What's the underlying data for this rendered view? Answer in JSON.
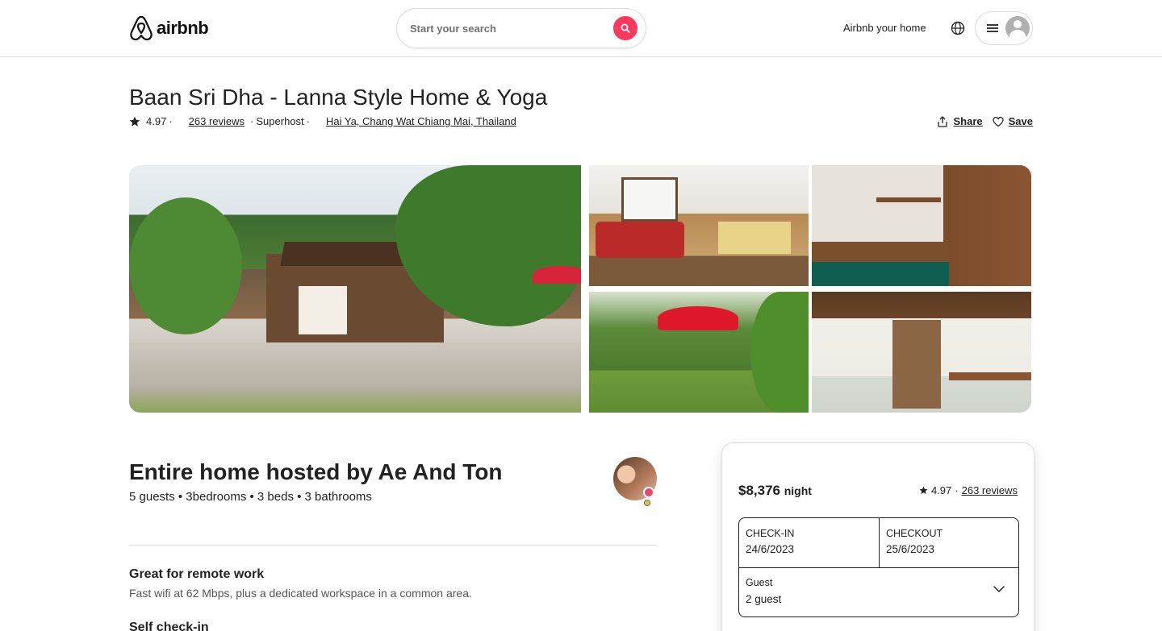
{
  "header": {
    "logo_text": "airbnb",
    "search_placeholder": "Start your search",
    "host_link": "Airbnb your home"
  },
  "listing": {
    "title": "Baan Sri Dha - Lanna Style Home & Yoga",
    "rating": "4.97",
    "reviews": "263 reviews",
    "superhost": "Superhost",
    "location": "Hai Ya, Chang Wat Chiang Mai, Thailand",
    "share_label": "Share",
    "save_label": "Save"
  },
  "host": {
    "title": "Entire home hosted by Ae And Ton",
    "summary": "5 guests • 3bedrooms • 3 beds • 3 bathrooms"
  },
  "features": [
    {
      "title": "Great for remote work",
      "desc": "Fast wifi at 62 Mbps, plus a dedicated workspace in a common area."
    },
    {
      "title": "Self check-in",
      "desc": ""
    }
  ],
  "booking": {
    "price": "$8,376",
    "per": "night",
    "rating": "4.97",
    "reviews": "263 reviews",
    "checkin_label": "CHECK-IN",
    "checkin_value": "24/6/2023",
    "checkout_label": "CHECKOUT",
    "checkout_value": "25/6/2023",
    "guest_label": "Guest",
    "guest_value": "2 guest"
  },
  "colors": {
    "brand": "#ff385c",
    "text": "#222222",
    "border": "#dddddd"
  },
  "icons": [
    "airbnb-logo-icon",
    "search-icon",
    "globe-icon",
    "menu-icon",
    "user-avatar-icon",
    "star-icon",
    "share-icon",
    "heart-icon",
    "chevron-down-icon"
  ]
}
